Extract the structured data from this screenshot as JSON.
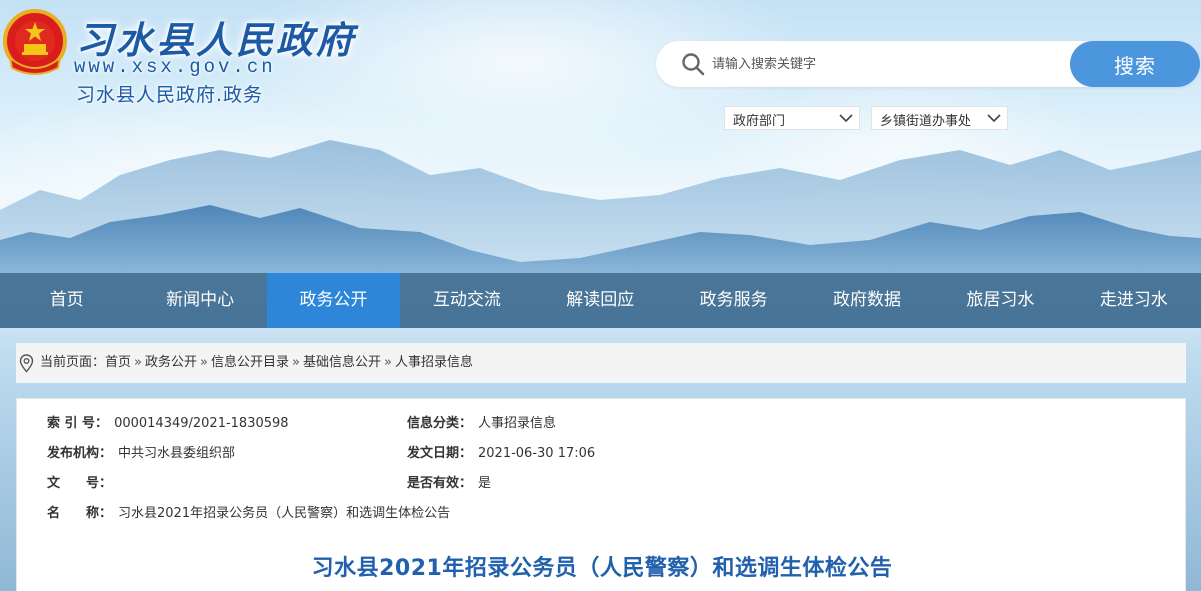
{
  "header": {
    "site_title": "习水县人民政府",
    "site_url": "www.xsx.gov.cn",
    "site_sub": "习水县人民政府.政务",
    "emblem_icon": "national-emblem-icon",
    "accent": "#1c5aa6"
  },
  "search": {
    "placeholder": "请输入搜索关键字",
    "button_label": "搜索",
    "icon": "search-icon"
  },
  "filters": {
    "department": "政府部门",
    "township": "乡镇街道办事处"
  },
  "nav": {
    "items": [
      {
        "label": "首页"
      },
      {
        "label": "新闻中心"
      },
      {
        "label": "政务公开"
      },
      {
        "label": "互动交流"
      },
      {
        "label": "解读回应"
      },
      {
        "label": "政务服务"
      },
      {
        "label": "政府数据"
      },
      {
        "label": "旅居习水"
      },
      {
        "label": "走进习水"
      }
    ],
    "active_label": "政务公开",
    "active_color": "#2e86d8"
  },
  "breadcrumb": {
    "prefix": "当前页面：",
    "items": [
      "首页",
      "政务公开",
      "信息公开目录",
      "基础信息公开",
      "人事招录信息"
    ],
    "separator": "»"
  },
  "meta": {
    "index_label": "索 引 号：",
    "index_value": "000014349/2021-1830598",
    "category_label": "信息分类：",
    "category_value": "人事招录信息",
    "publisher_label": "发布机构：",
    "publisher_value": "中共习水县委组织部",
    "date_label": "发文日期：",
    "date_value": "2021-06-30 17:06",
    "docno_label": "文　　号：",
    "docno_value": "",
    "valid_label": "是否有效：",
    "valid_value": "是",
    "name_label": "名　　称：",
    "name_value": "习水县2021年招录公务员（人民警察）和选调生体检公告"
  },
  "document": {
    "title": "习水县2021年招录公务员（人民警察）和选调生体检公告"
  }
}
